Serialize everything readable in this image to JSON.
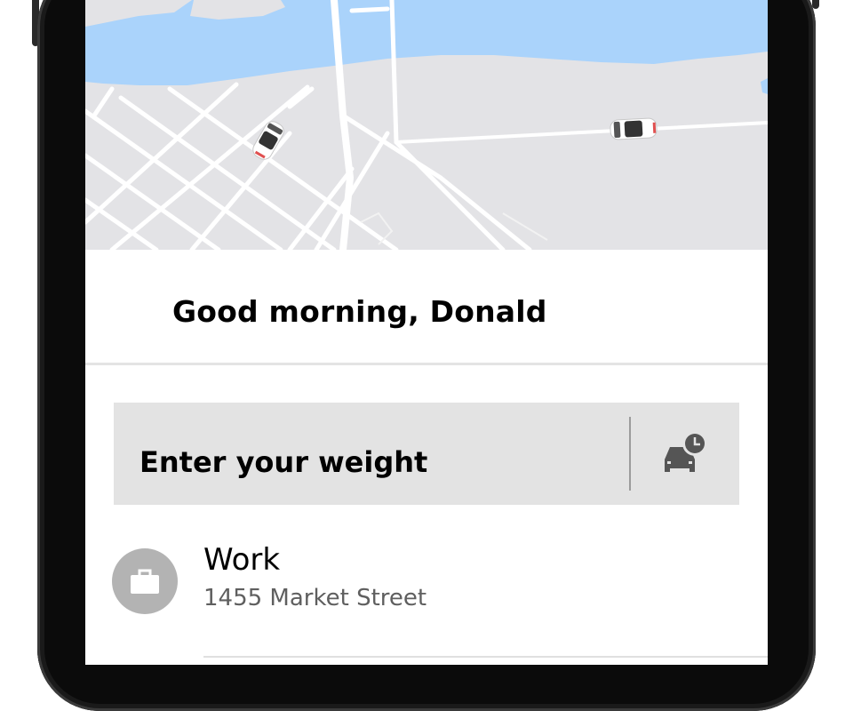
{
  "greeting": "Good morning, Donald",
  "search": {
    "label": "Enter your weight"
  },
  "icons": {
    "schedule": "car-clock-icon",
    "work": "briefcase-icon"
  },
  "saved_places": [
    {
      "title": "Work",
      "address": "1455 Market Street"
    }
  ],
  "colors": {
    "map_land": "#e3e3e6",
    "map_water": "#aad3fb",
    "search_bg": "#e3e3e3",
    "icon_gray": "#b3b3b3"
  }
}
